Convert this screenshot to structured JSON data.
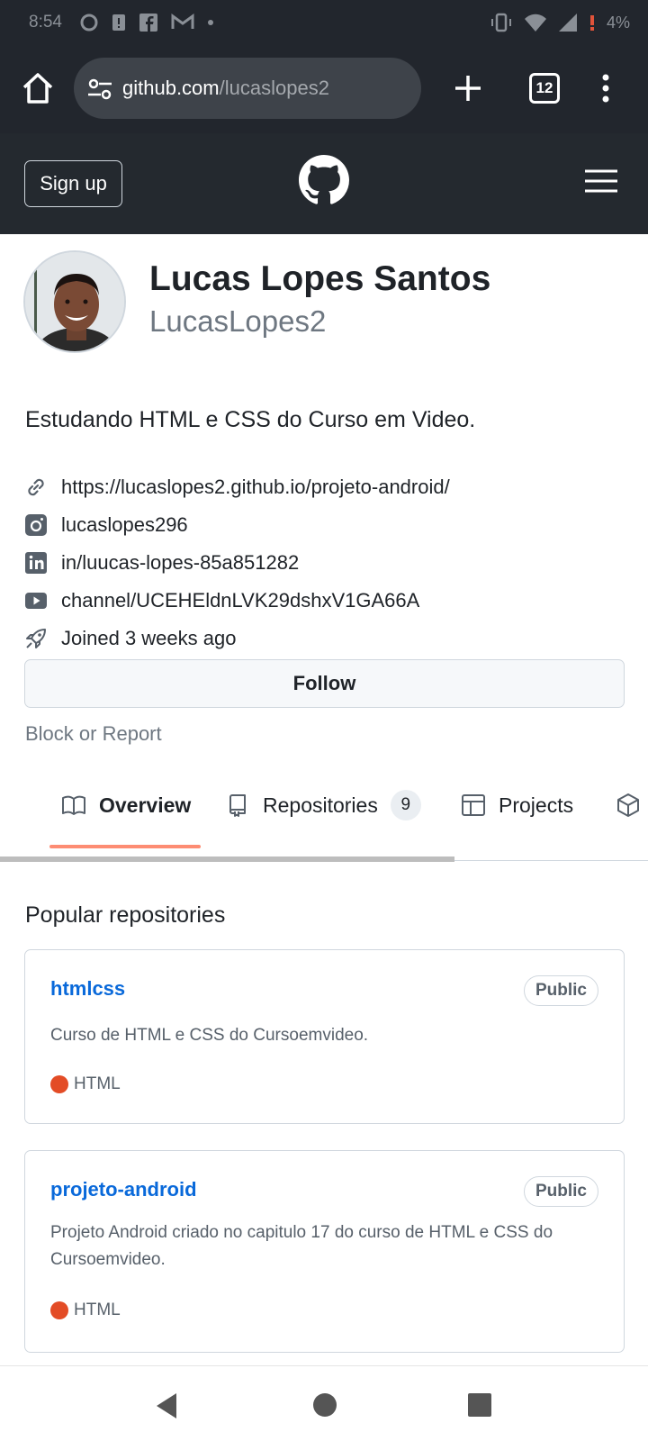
{
  "status_bar": {
    "time": "8:54",
    "battery": "4%",
    "icons": [
      "vibrate-icon",
      "wifi-icon",
      "signal-icon",
      "battery-alert-icon"
    ]
  },
  "browser": {
    "url_host": "github.com",
    "url_path": "/lucaslopes2",
    "tab_count": "12"
  },
  "header": {
    "signup_label": "Sign up"
  },
  "profile": {
    "full_name": "Lucas Lopes Santos",
    "username": "LucasLopes2",
    "bio": "Estudando HTML e CSS do Curso em Video.",
    "website": "https://lucaslopes2.github.io/projeto-android/",
    "instagram": "lucaslopes296",
    "linkedin": "in/luucas-lopes-85a851282",
    "youtube": "channel/UCEHEldnLVK29dshxV1GA66A",
    "joined": "Joined 3 weeks ago",
    "follow_label": "Follow",
    "block_label": "Block or Report"
  },
  "tabs": {
    "overview": "Overview",
    "repositories": "Repositories",
    "repositories_count": "9",
    "projects": "Projects"
  },
  "popular": {
    "title": "Popular repositories",
    "repos": [
      {
        "name": "htmlcss",
        "visibility": "Public",
        "description": "Curso de HTML e CSS do Cursoemvideo.",
        "language": "HTML",
        "language_color": "#e34c26"
      },
      {
        "name": "projeto-android",
        "visibility": "Public",
        "description": "Projeto Android criado no capitulo 17 do curso de HTML e CSS do Cursoemvideo.",
        "language": "HTML",
        "language_color": "#e34c26"
      }
    ]
  },
  "colors": {
    "link_blue": "#0969da",
    "tab_accent": "#fd8c73",
    "header_dark": "#24292f"
  }
}
